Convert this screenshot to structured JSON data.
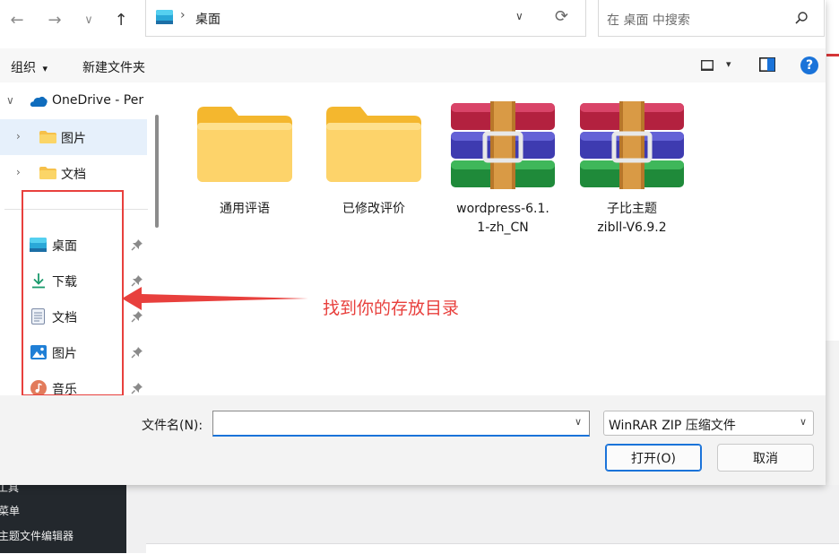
{
  "toolbar_nav": {
    "back": "←",
    "forward": "→",
    "recent": "∨",
    "up": "↑"
  },
  "address": {
    "separator": "›",
    "path": "桌面",
    "dropdown": "∨",
    "refresh": "⟳"
  },
  "search": {
    "placeholder": "在 桌面 中搜索"
  },
  "commandbar": {
    "organize": "组织",
    "organize_caret": "▾",
    "new_folder": "新建文件夹",
    "view_caret": "▾",
    "help": "?"
  },
  "sidebar": {
    "onedrive": "OneDrive - Per",
    "tree": [
      {
        "label": "图片"
      },
      {
        "label": "文档"
      }
    ],
    "quick": [
      {
        "label": "桌面",
        "icon": "desktop-icon"
      },
      {
        "label": "下载",
        "icon": "download-icon"
      },
      {
        "label": "文档",
        "icon": "document-icon"
      },
      {
        "label": "图片",
        "icon": "pictures-icon"
      },
      {
        "label": "音乐",
        "icon": "music-icon"
      }
    ]
  },
  "files": [
    {
      "name": "通用评语",
      "type": "folder"
    },
    {
      "name": "已修改评价",
      "type": "folder"
    },
    {
      "name": "wordpress-6.1.\n1-zh_CN",
      "type": "winrar-archive"
    },
    {
      "name": "子比主题\nzibll-V6.9.2",
      "type": "winrar-archive"
    }
  ],
  "annotation": {
    "text": "找到你的存放目录",
    "color": "#e8403d"
  },
  "bottom": {
    "filename_label": "文件名(N):",
    "filename_value": "",
    "filetype": "WinRAR ZIP 压缩文件",
    "open": "打开(O)",
    "cancel": "取消"
  },
  "background_page": {
    "menu": [
      "工具",
      "菜单",
      "主题文件编辑器"
    ]
  },
  "colors": {
    "accent": "#0067c0",
    "folder": "#f8c53a",
    "annotation": "#e8403d"
  }
}
